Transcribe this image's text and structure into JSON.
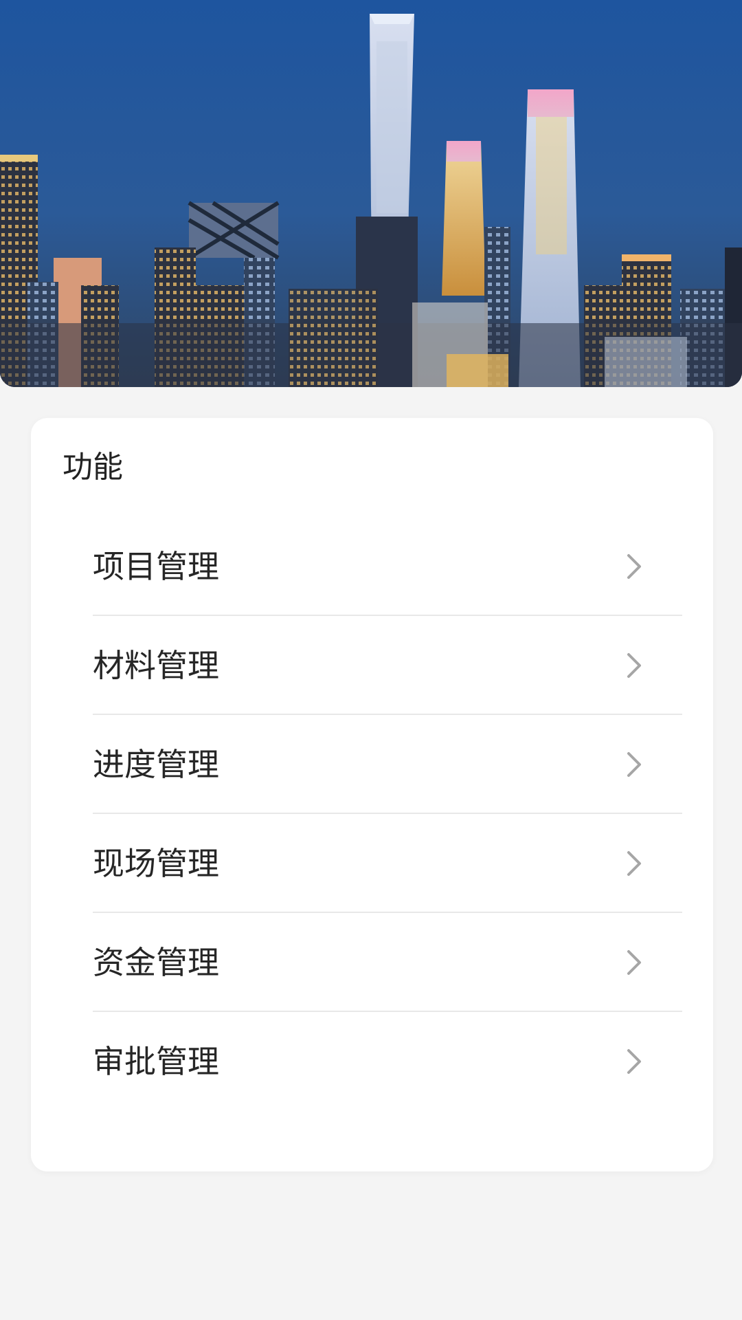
{
  "banner": {
    "image": "city-skyline-night"
  },
  "section": {
    "title": "功能"
  },
  "menu": {
    "items": [
      {
        "label": "项目管理",
        "icon": "chevron-right-icon"
      },
      {
        "label": "材料管理",
        "icon": "chevron-right-icon"
      },
      {
        "label": "进度管理",
        "icon": "chevron-right-icon"
      },
      {
        "label": "现场管理",
        "icon": "chevron-right-icon"
      },
      {
        "label": "资金管理",
        "icon": "chevron-right-icon"
      },
      {
        "label": "审批管理",
        "icon": "chevron-right-icon"
      }
    ]
  },
  "colors": {
    "background": "#f4f4f4",
    "card": "#ffffff",
    "text": "#262626",
    "chevron": "#a6a6a6",
    "divider": "#e8e8e8"
  }
}
